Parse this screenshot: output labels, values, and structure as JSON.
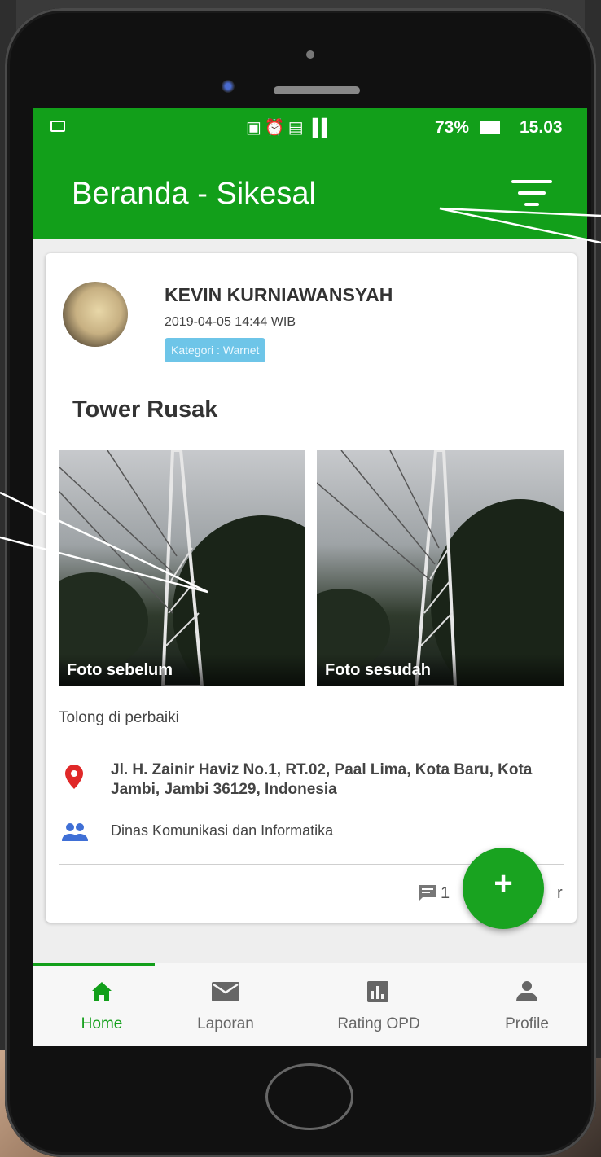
{
  "status_bar": {
    "battery": "73%",
    "time": "15.03"
  },
  "app_bar": {
    "title": "Beranda - Sikesal"
  },
  "post": {
    "user_name": "KEVIN KURNIAWANSYAH",
    "date": "2019-04-05 14:44 WIB",
    "category": "Kategori : Warnet",
    "title": "Tower Rusak",
    "photo_before_label": "Foto sebelum",
    "photo_after_label": "Foto sesudah",
    "description": "Tolong di perbaiki",
    "address": "Jl. H. Zainir Haviz No.1, RT.02, Paal Lima, Kota Baru, Kota Jambi, Jambi 36129, Indonesia",
    "agency": "Dinas Komunikasi dan Informatika",
    "comment_count": "1",
    "comment_suffix": "r"
  },
  "fab": {
    "label": "+"
  },
  "bottom_nav": {
    "items": [
      {
        "label": "Home",
        "icon": "home-icon",
        "active": true
      },
      {
        "label": "Laporan",
        "icon": "mail-icon",
        "active": false
      },
      {
        "label": "Rating OPD",
        "icon": "bar-chart-icon",
        "active": false
      },
      {
        "label": "Profile",
        "icon": "person-icon",
        "active": false
      }
    ]
  },
  "colors": {
    "primary": "#129f1a",
    "badge": "#6ec5e8",
    "pin": "#e02828",
    "people": "#3f6fd6"
  }
}
